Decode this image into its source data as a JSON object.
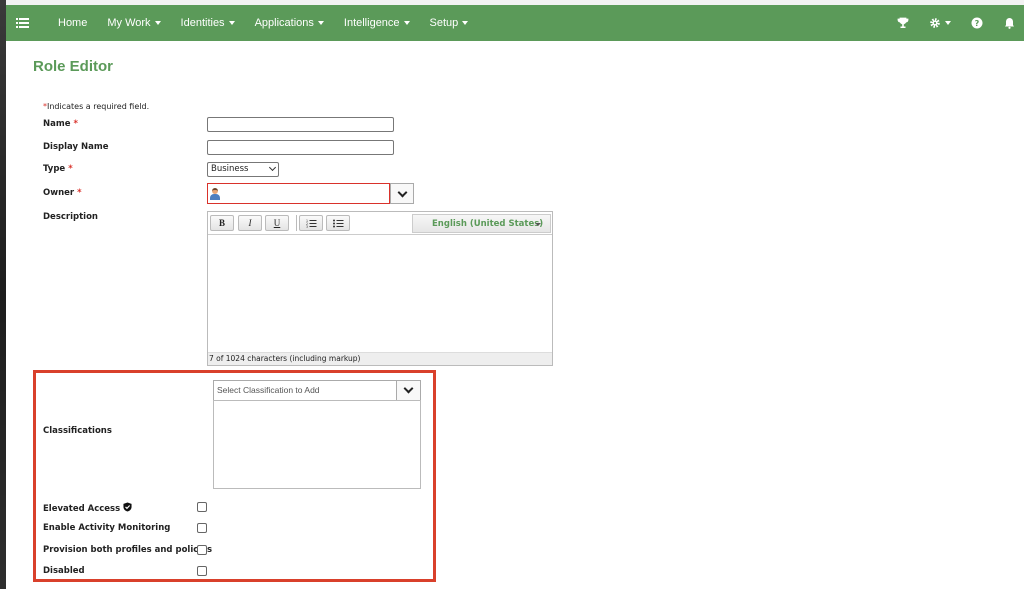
{
  "nav": {
    "items": [
      "Home",
      "My Work",
      "Identities",
      "Applications",
      "Intelligence",
      "Setup"
    ],
    "brand_color": "#5b9a59"
  },
  "page": {
    "title": "Role Editor",
    "required_note_star": "*",
    "required_note": "Indicates a required field."
  },
  "form": {
    "name_label": "Name",
    "display_name_label": "Display Name",
    "type_label": "Type",
    "type_value": "Business",
    "owner_label": "Owner",
    "description_label": "Description",
    "required_star": "*",
    "editor": {
      "bold": "B",
      "italic": "I",
      "underline": "U",
      "language": "English (United States)",
      "status": "7 of 1024 characters (including markup)"
    },
    "classifications_label": "Classifications",
    "classification_placeholder": "Select Classification to Add",
    "elevated_access_label": "Elevated Access",
    "activity_monitoring_label": "Enable Activity Monitoring",
    "provision_label": "Provision both profiles and policies",
    "disabled_label": "Disabled"
  },
  "highlight_color": "#d9402b",
  "required_color": "#d9322b"
}
